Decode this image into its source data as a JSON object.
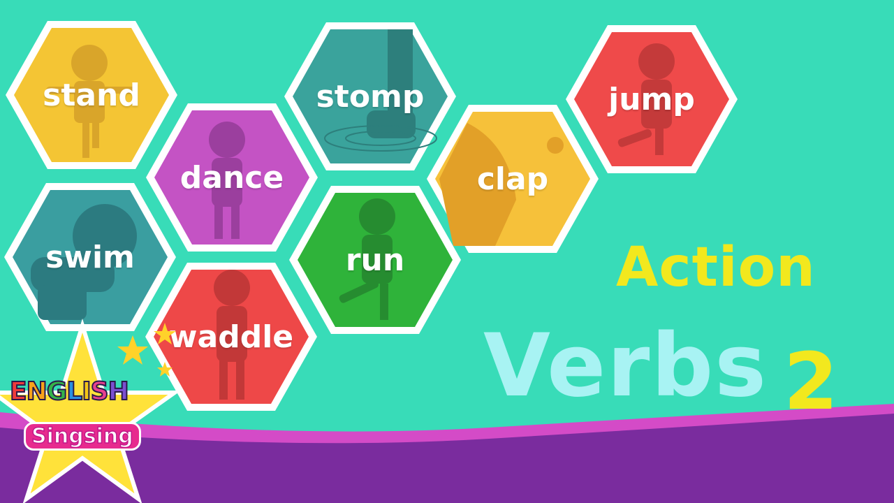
{
  "tiles": [
    {
      "id": "stand",
      "label": "stand",
      "color": "#f4c534",
      "silhouette": "#d9a52a"
    },
    {
      "id": "stomp",
      "label": "stomp",
      "color": "#3aa39c",
      "silhouette": "#2d7f7c"
    },
    {
      "id": "jump",
      "label": "jump",
      "color": "#ef4a4a",
      "silhouette": "#c43a3a"
    },
    {
      "id": "dance",
      "label": "dance",
      "color": "#c453c4",
      "silhouette": "#9b3f9e"
    },
    {
      "id": "clap",
      "label": "clap",
      "color": "#f6c13a",
      "silhouette": "#e2a028"
    },
    {
      "id": "swim",
      "label": "swim",
      "color": "#3a9ea0",
      "silhouette": "#2c7b80"
    },
    {
      "id": "run",
      "label": "run",
      "color": "#2fb33a",
      "silhouette": "#268c30"
    },
    {
      "id": "waddle",
      "label": "waddle",
      "color": "#ee4848",
      "silhouette": "#c23838"
    }
  ],
  "title": {
    "line1": "Action",
    "line2": "Verbs",
    "number": "2"
  },
  "logo": {
    "letters": [
      "E",
      "N",
      "G",
      "L",
      "I",
      "S",
      "H"
    ],
    "letter_colors": [
      "#ee3b3b",
      "#f7a21b",
      "#34b34a",
      "#2a8fe0",
      "#f2c417",
      "#e8408f",
      "#7b4fd0"
    ],
    "subtitle": "Singsing"
  },
  "colors": {
    "background": "#38dcb8",
    "band_purple": "#7a2c9e",
    "band_magenta": "#d44bc7",
    "action_yellow": "#f2e81e",
    "verbs_cyan": "#a8f3f3",
    "star_yellow": "#ffe23a"
  }
}
